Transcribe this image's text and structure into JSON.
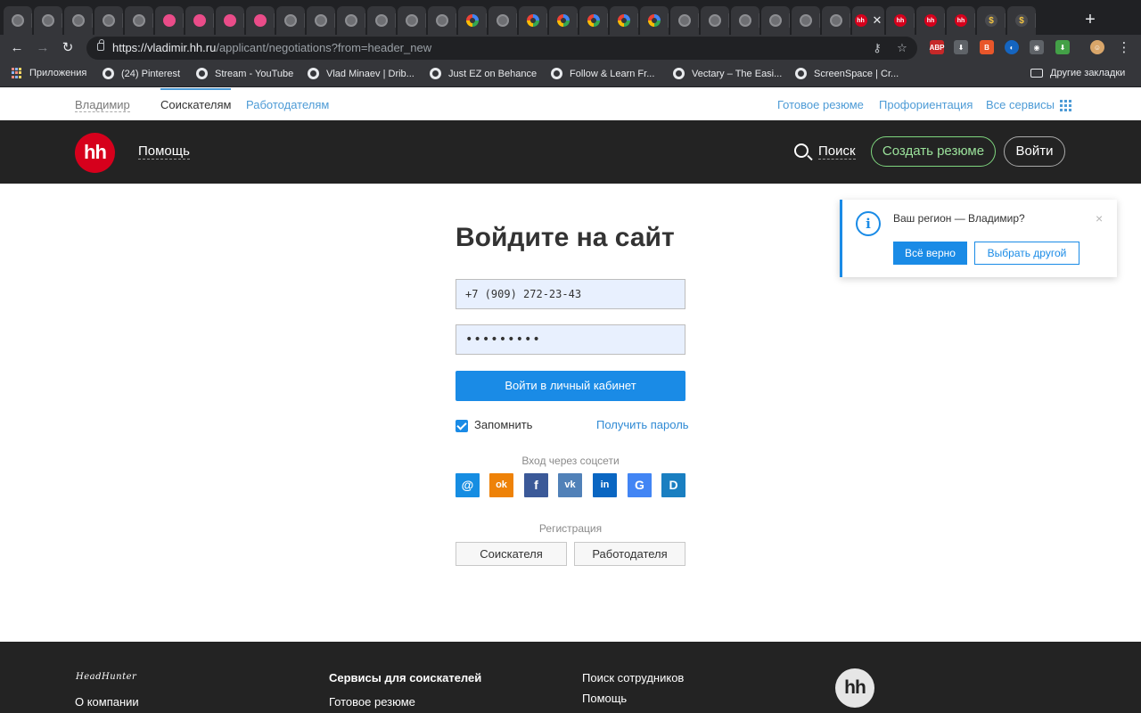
{
  "browser": {
    "tabs": [
      {
        "favicon": "globe-icon"
      },
      {
        "favicon": "globe-icon"
      },
      {
        "favicon": "globe-icon"
      },
      {
        "favicon": "globe-icon"
      },
      {
        "favicon": "globe-icon"
      },
      {
        "favicon": "dribbble-icon"
      },
      {
        "favicon": "dribbble-icon"
      },
      {
        "favicon": "dribbble-icon"
      },
      {
        "favicon": "dribbble-icon"
      },
      {
        "favicon": "globe-icon"
      },
      {
        "favicon": "globe-icon"
      },
      {
        "favicon": "globe-icon"
      },
      {
        "favicon": "globe-icon"
      },
      {
        "favicon": "globe-icon"
      },
      {
        "favicon": "globe-icon"
      },
      {
        "favicon": "google-icon"
      },
      {
        "favicon": "globe-icon"
      },
      {
        "favicon": "google-icon"
      },
      {
        "favicon": "google-icon"
      },
      {
        "favicon": "google-icon"
      },
      {
        "favicon": "google-icon"
      },
      {
        "favicon": "google-icon"
      },
      {
        "favicon": "globe-icon"
      },
      {
        "favicon": "globe-icon"
      },
      {
        "favicon": "globe-icon"
      },
      {
        "favicon": "globe-icon"
      },
      {
        "favicon": "globe-icon"
      },
      {
        "favicon": "globe-icon"
      },
      {
        "favicon": "hh-icon",
        "active": true
      },
      {
        "favicon": "hh-icon"
      },
      {
        "favicon": "hh-icon"
      },
      {
        "favicon": "hh-icon"
      },
      {
        "favicon": "other-icon"
      },
      {
        "favicon": "other-icon"
      }
    ],
    "active_tab_close": "✕",
    "new_tab": "+",
    "url_host": "https://vladimir.hh.ru",
    "url_path": "/applicant/negotiations?from=header_new",
    "bookmarks": [
      "Приложения",
      "(24) Pinterest",
      "Stream - YouTube",
      "Vlad Minaev | Drib...",
      "Just EZ on Behance",
      "Follow & Learn Fr...",
      "Vectary – The Easi...",
      "ScreenSpace | Cr..."
    ],
    "other_bookmarks": "Другие закладки"
  },
  "site_top": {
    "city": "Владимир",
    "seekers": "Соискателям",
    "employers": "Работодателям",
    "ready_resume": "Готовое резюме",
    "career": "Профориентация",
    "all_services": "Все сервисы"
  },
  "header": {
    "logo": "hh",
    "help": "Помощь",
    "search": "Поиск",
    "create_resume": "Создать резюме",
    "login": "Войти"
  },
  "login": {
    "title": "Войдите на сайт",
    "phone_value": "+7 (909) 272-23-43",
    "password_value": "•••••••••",
    "submit": "Войти в личный кабинет",
    "remember": "Запомнить",
    "get_password": "Получить пароль",
    "social_label": "Вход через соцсети",
    "socials": [
      {
        "name": "mail-icon",
        "glyph": "@",
        "color": "#168de2"
      },
      {
        "name": "odnoklassniki-icon",
        "glyph": "ok",
        "color": "#ee8208"
      },
      {
        "name": "facebook-icon",
        "glyph": "f",
        "color": "#3b5998"
      },
      {
        "name": "vk-icon",
        "glyph": "vk",
        "color": "#5181b8"
      },
      {
        "name": "linkedin-icon",
        "glyph": "in",
        "color": "#0a66c2"
      },
      {
        "name": "google-icon",
        "glyph": "G",
        "color": "#4285f4"
      },
      {
        "name": "d-icon",
        "glyph": "D",
        "color": "#1a7fc1"
      }
    ],
    "register_label": "Регистрация",
    "register_seeker": "Соискателя",
    "register_employer": "Работодателя"
  },
  "region_popup": {
    "text": "Ваш регион — Владимир?",
    "confirm": "Всё верно",
    "choose_other": "Выбрать другой",
    "close": "×"
  },
  "footer": {
    "brand": "HeadHunter",
    "about": "О компании",
    "seekers_services": "Сервисы для соискателей",
    "ready_resume": "Готовое резюме",
    "find_staff": "Поиск сотрудников",
    "help": "Помощь",
    "logo": "hh"
  },
  "colors": {
    "accent": "#1a8be6",
    "brand_red": "#d6001c",
    "header_bg": "#232323",
    "create_green": "#9be29b"
  }
}
